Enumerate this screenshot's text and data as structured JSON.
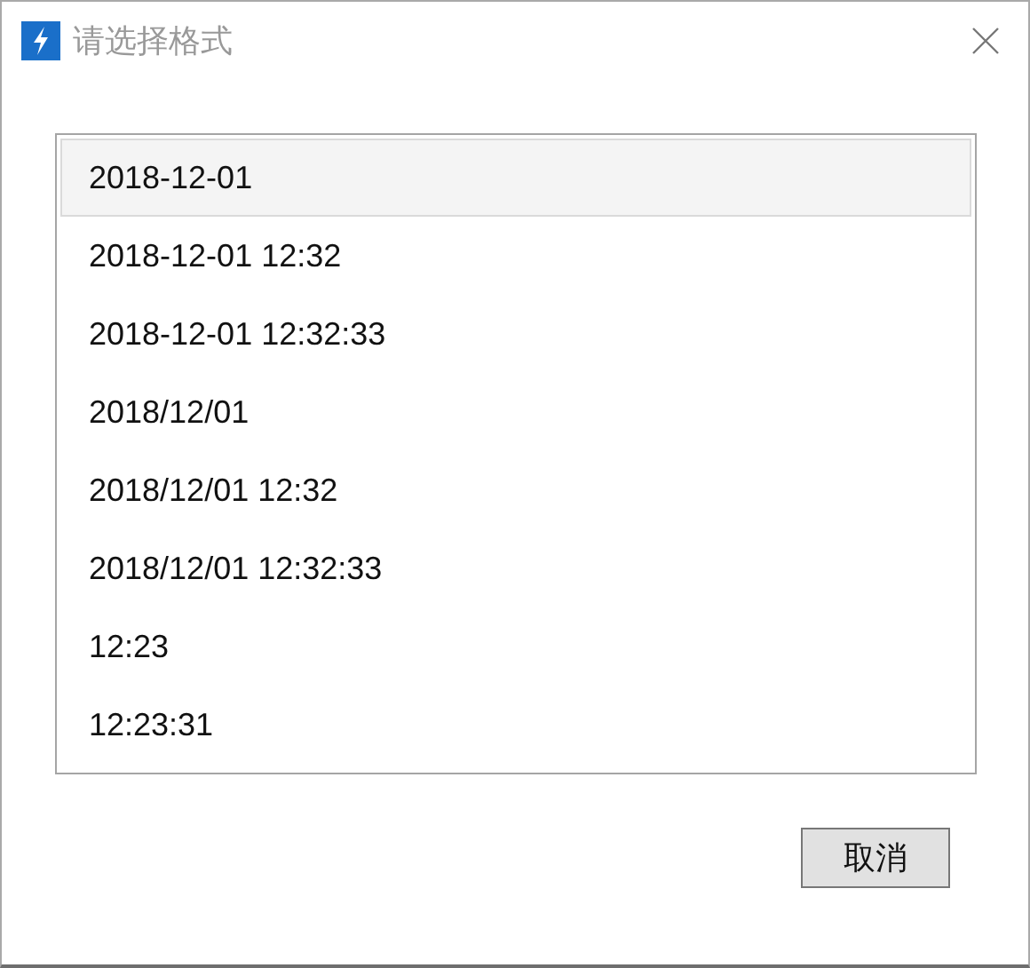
{
  "window": {
    "title": "请选择格式"
  },
  "formats": [
    {
      "label": "2018-12-01",
      "selected": true
    },
    {
      "label": "2018-12-01 12:32",
      "selected": false
    },
    {
      "label": "2018-12-01 12:32:33",
      "selected": false
    },
    {
      "label": "2018/12/01",
      "selected": false
    },
    {
      "label": "2018/12/01 12:32",
      "selected": false
    },
    {
      "label": "2018/12/01 12:32:33",
      "selected": false
    },
    {
      "label": "12:23",
      "selected": false
    },
    {
      "label": "12:23:31",
      "selected": false
    }
  ],
  "buttons": [
    "取消"
  ]
}
